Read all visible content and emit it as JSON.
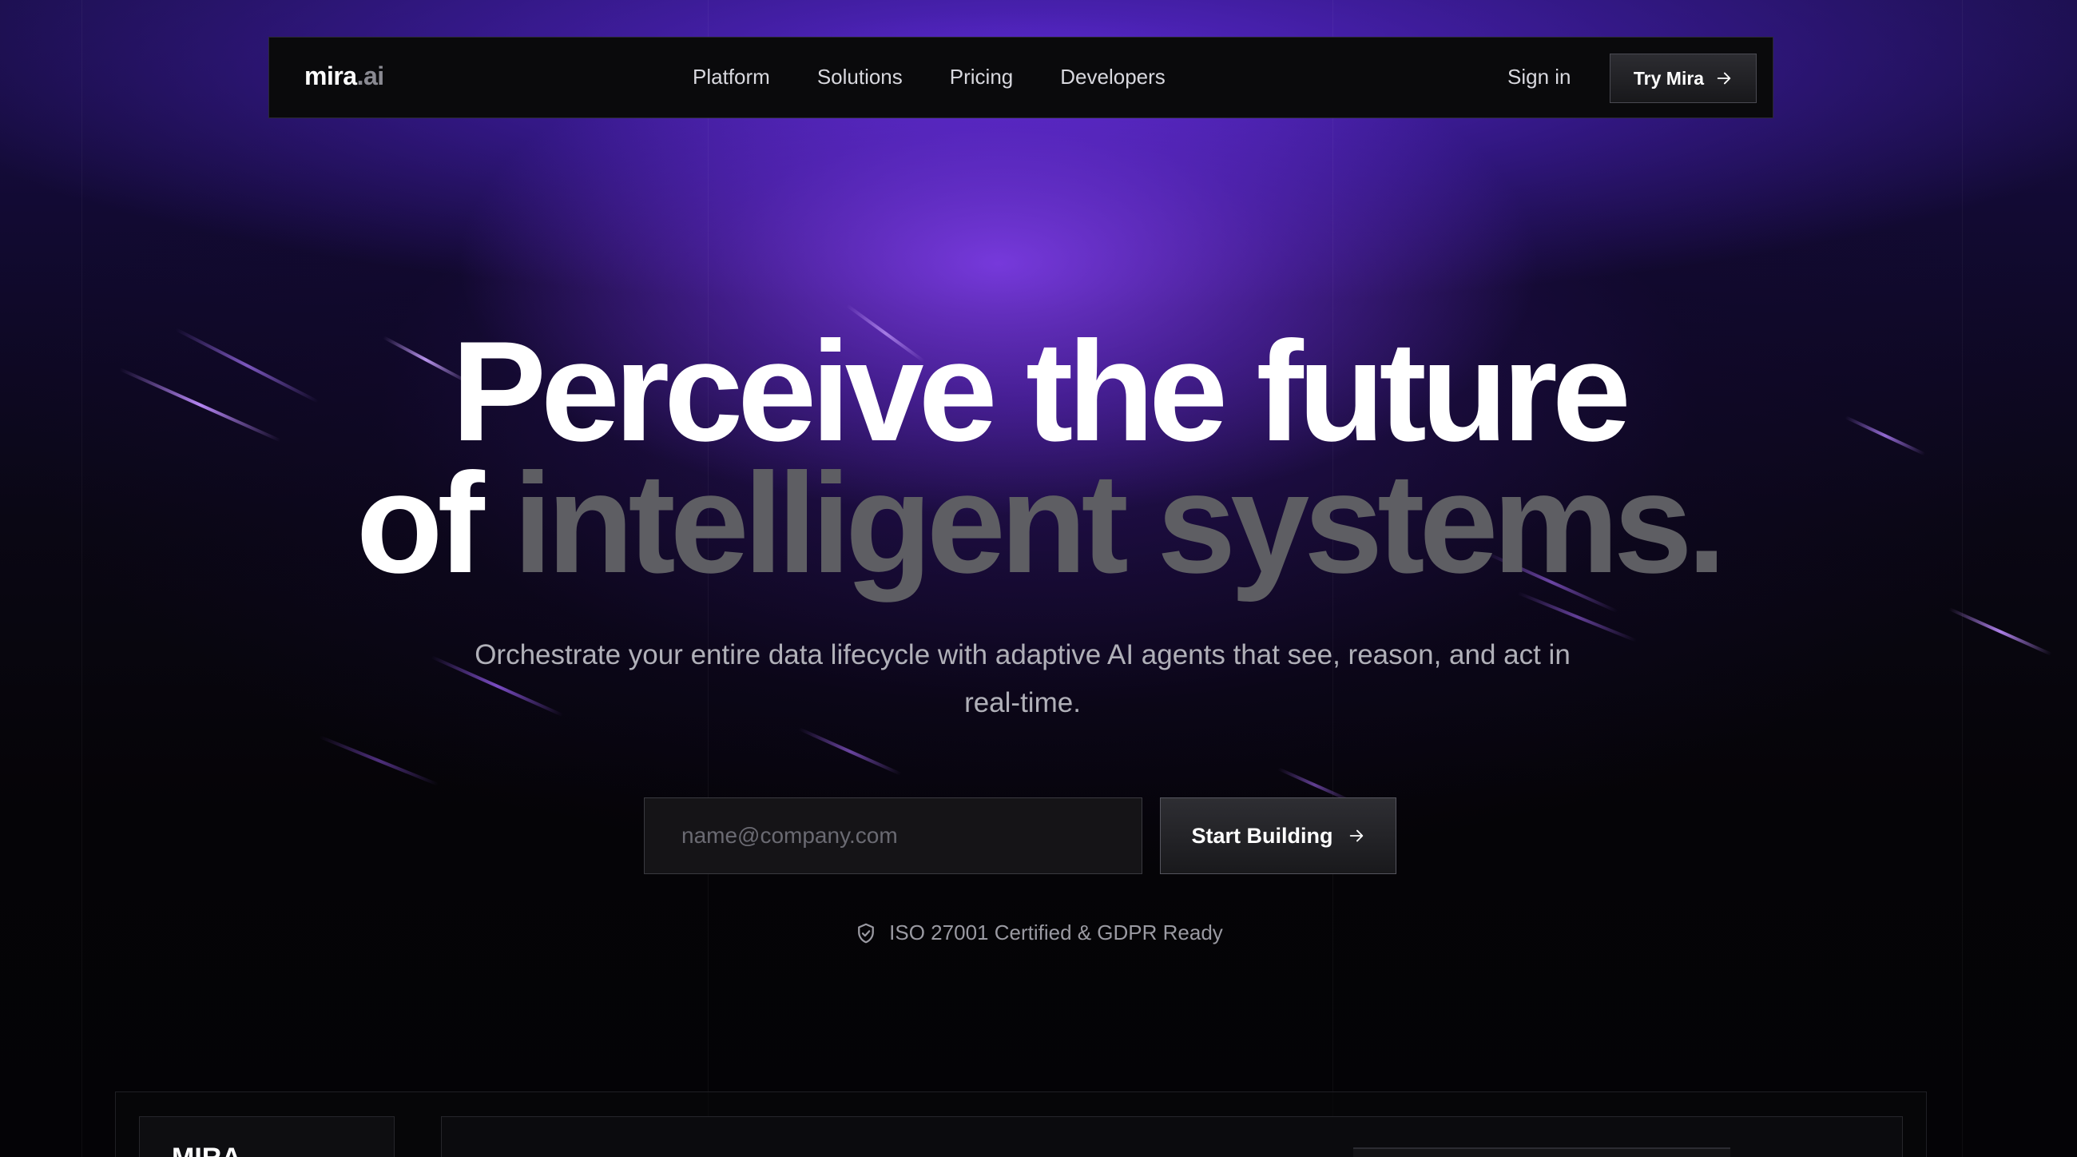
{
  "nav": {
    "logo_main": "mira",
    "logo_suffix": ".ai",
    "links": [
      {
        "label": "Platform"
      },
      {
        "label": "Solutions"
      },
      {
        "label": "Pricing"
      },
      {
        "label": "Developers"
      }
    ],
    "signin_label": "Sign in",
    "cta_label": "Try Mira",
    "cta_icon": "arrow-right-icon"
  },
  "hero": {
    "line1": "Perceive the future",
    "line2_white": "of",
    "line2_gray": "intelligent systems.",
    "subtitle": "Orchestrate your entire data lifecycle with adaptive AI agents that see, reason, and act in real-time."
  },
  "signup": {
    "email_placeholder": "name@company.com",
    "button_label": "Start Building",
    "button_icon": "arrow-right-icon"
  },
  "trust": {
    "icon": "shield-check-icon",
    "text": "ISO 27001 Certified & GDPR Ready"
  },
  "preview": {
    "sidebar_logo": "MIRA"
  },
  "colors": {
    "accent_purple": "#7c3aed",
    "background": "#050407",
    "muted_text": "#5e5e63"
  }
}
